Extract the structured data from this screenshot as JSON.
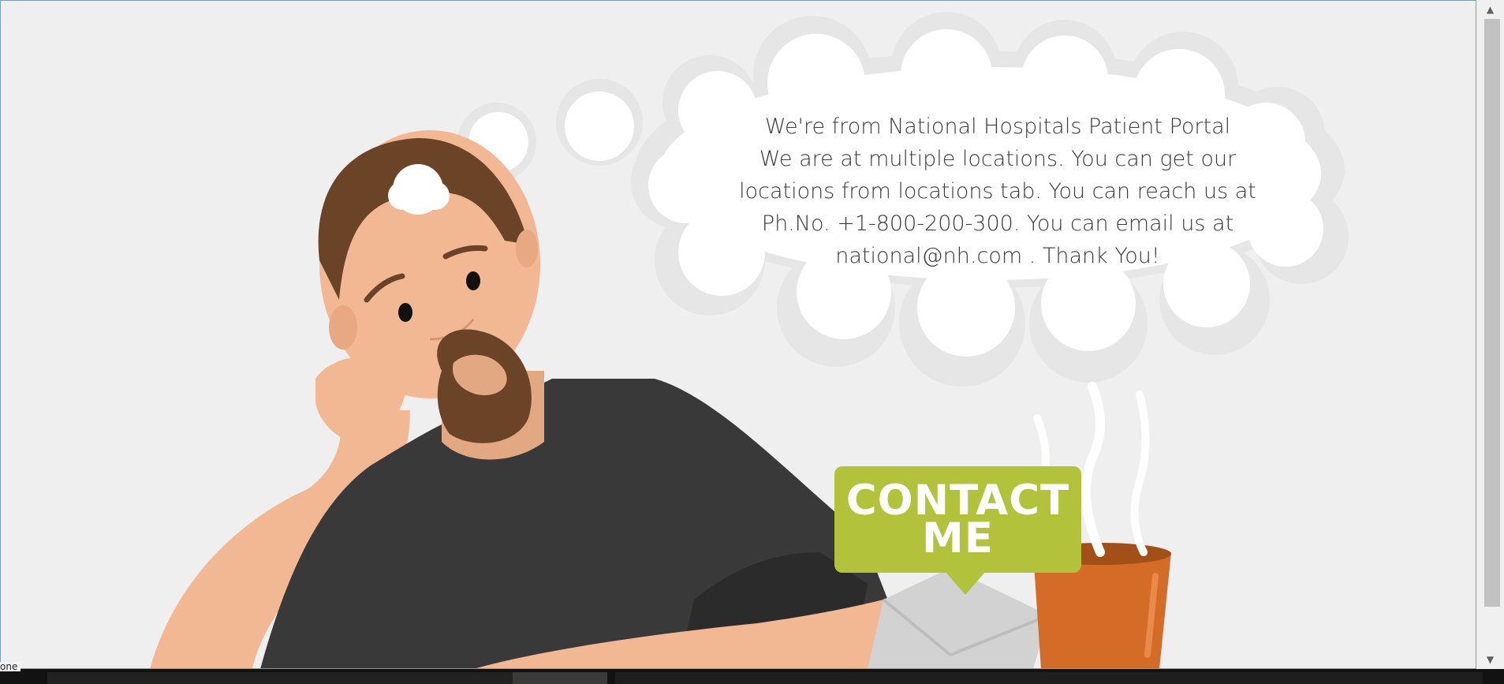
{
  "message": {
    "lines": [
      "We're from National Hospitals Patient Portal",
      "We are at multiple locations. You can get our",
      "locations from locations tab. You can reach us at",
      "Ph.No. +1-800-200-300. You can email us at",
      "national@nh.com . Thank You!"
    ]
  },
  "contact_button": {
    "line1": "CONTACT",
    "line2": "ME",
    "color": "#b2c33b"
  },
  "status_bar": {
    "text": "one"
  },
  "scrollbar": {
    "up_glyph": "▲",
    "down_glyph": "▼"
  },
  "colors": {
    "background": "#efefef",
    "shirt": "#393939",
    "skin": "#f2b893",
    "beard": "#6b4428",
    "mug": "#d46b26"
  }
}
